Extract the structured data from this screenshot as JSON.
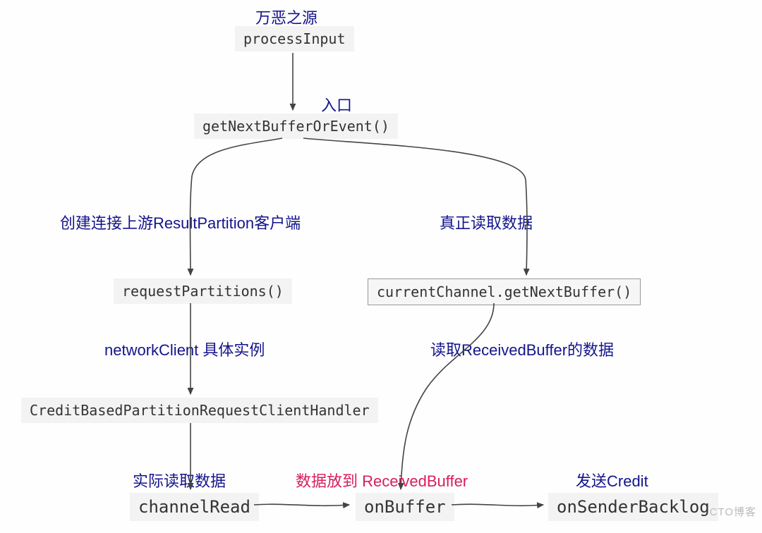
{
  "labels": {
    "root_cn": "万恶之源",
    "entry_cn": "入口",
    "left_desc": "创建连接上游ResultPartition客户端",
    "right_desc": "真正读取数据",
    "nc_instance": "networkClient 具体实例",
    "read_recv": "读取ReceivedBuffer的数据",
    "actual_read": "实际读取数据",
    "put_recv": "数据放到 ReceivedBuffer",
    "send_credit": "发送Credit"
  },
  "nodes": {
    "process_input": "processInput",
    "get_next_buf_or_event": "getNextBufferOrEvent()",
    "request_partitions": "requestPartitions()",
    "current_channel": "currentChannel.getNextBuffer()",
    "cbprch": "CreditBasedPartitionRequestClientHandler",
    "channel_read": "channelRead",
    "on_buffer": "onBuffer",
    "on_sender_backlog": "onSenderBacklog"
  },
  "watermark": "CTO博客"
}
